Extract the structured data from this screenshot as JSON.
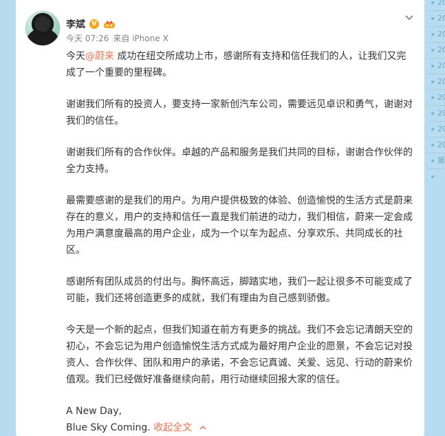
{
  "post": {
    "author": "李斌",
    "verified_badge": "V",
    "time": "今天 07:26",
    "source": "来自 iPhone X",
    "intro_before_mention": "今天",
    "mention": "@蔚来",
    "intro_after_mention": " 成功在纽交所成功上市，感谢所有支持和信任我们的人，让我们又完成了一个重要的里程碑。",
    "paragraphs": [
      "谢谢我们所有的投资人，要支持一家新创汽车公司，需要远见卓识和勇气，谢谢对我们的信任。",
      "谢谢我们所有的合作伙伴。卓越的产品和服务是我们共同的目标，谢谢合作伙伴的全力支持。",
      "最需要感谢的是我们的用户。为用户提供极致的体验、创造愉悦的生活方式是蔚来存在的意义，用户的支持和信任一直是我们前进的动力，我们相信，蔚来一定会成为用户满意度最高的用户企业，成为一个以车为起点、分享欢乐、共同成长的社区。",
      "感谢所有团队成员的付出与。胸怀高远，脚踏实地，我们一起让很多不可能变成了可能，我们还将创造更多的成就，我们有理由为自己感到骄傲。",
      "今天是一个新的起点，但我们知道在前方有更多的挑战。我们不会忘记清朗天空的初心，不会忘记为用户创造愉悦生活方式成为最好用户企业的愿景，不会忘记对投资人、合作伙伴、团队和用户的承诺，不会忘记真诚、关爱、远见、行动的蔚来价值观。我们已经做好准备继续向前，用行动继续回报大家的信任。"
    ],
    "closing_line1": "A New Day,",
    "closing_line2": "Blue Sky Coming.",
    "collapse_label": "收起全文",
    "icons": {
      "menu": "chevron-down-icon",
      "collapse": "chevron-up-icon"
    },
    "colors": {
      "mention": "#eb7350",
      "badge": "#f6a623"
    }
  },
  "sidebar": {
    "items": [
      "20",
      "20",
      "20",
      "20",
      "20",
      "20",
      "20",
      "20",
      "20",
      "20",
      "第"
    ]
  }
}
